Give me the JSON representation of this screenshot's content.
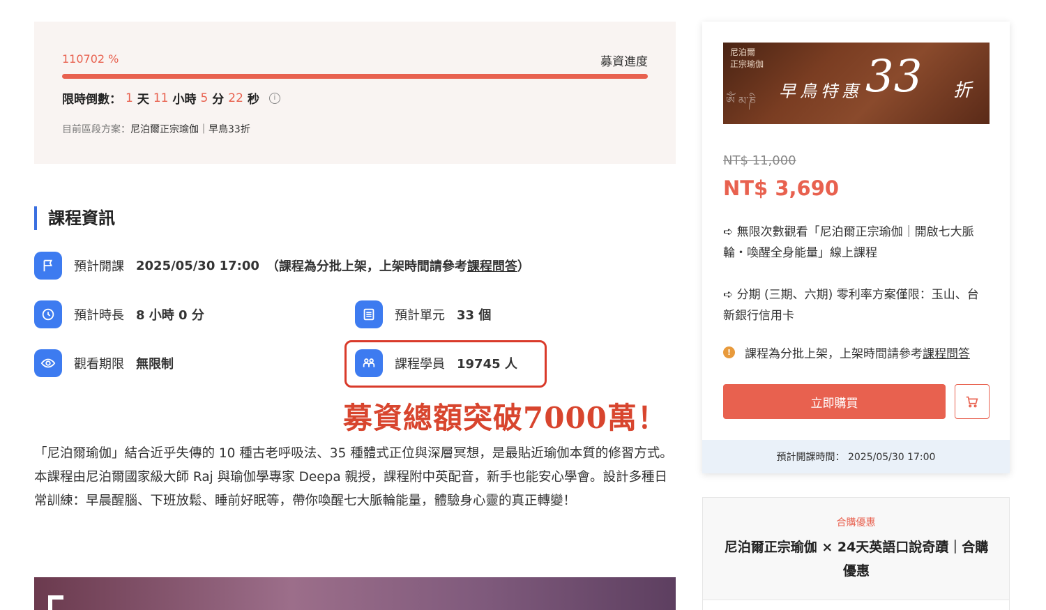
{
  "funding": {
    "percent": "110702 %",
    "label": "募資進度",
    "countdown": {
      "prefix": "限時倒數：",
      "days": "1",
      "days_unit": "天",
      "hours": "11",
      "hours_unit": "小時",
      "minutes": "5",
      "minutes_unit": "分",
      "seconds": "22",
      "seconds_unit": "秒"
    },
    "stage_label": "目前區段方案：",
    "stage_value": "尼泊爾正宗瑜伽｜早鳥33折"
  },
  "course_info": {
    "title": "課程資訊",
    "start": {
      "label": "預計開課",
      "value": "2025/05/30 17:00",
      "note_prefix": "（課程為分批上架，上架時間請參考",
      "note_link": "課程問答",
      "note_suffix": "）"
    },
    "duration": {
      "label": "預計時長",
      "value": "8 小時 0 分"
    },
    "units": {
      "label": "預計單元",
      "value": "33 個"
    },
    "access": {
      "label": "觀看期限",
      "value": "無限制"
    },
    "students": {
      "label": "課程學員",
      "value": "19745 人"
    }
  },
  "headline": "募資總額突破7000萬！",
  "description": "「尼泊爾瑜伽」結合近乎失傳的 10 種古老呼吸法、35 種體式正位與深層冥想，是最貼近瑜伽本質的修習方式。本課程由尼泊爾國家級大師 Raj 與瑜伽學專家 Deepa 親授，課程附中英配音，新手也能安心學會。設計多種日常訓練：早晨醒腦、下班放鬆、睡前好眠等，帶你喚醒七大脈輪能量，體驗身心靈的真正轉變！",
  "purchase": {
    "banner": {
      "small_line1": "尼泊爾",
      "small_line2": "正宗瑜伽",
      "promo": "早鳥特惠",
      "number": "33",
      "suffix": "折"
    },
    "old_price": "NT$ 11,000",
    "price": "NT$ 3,690",
    "feature1": "➪ 無限次數觀看「尼泊爾正宗瑜伽｜開啟七大脈輪・喚醒全身能量」線上課程",
    "feature2": "➪ 分期 (三期、六期) 零利率方案僅限：玉山、台新銀行信用卡",
    "notice_text": "課程為分批上架，上架時間請參考",
    "notice_link": "課程問答",
    "buy_label": "立即購買",
    "footer": "預計開課時間： 2025/05/30 17:00"
  },
  "bundle": {
    "tag": "合購優惠",
    "title": "尼泊爾正宗瑜伽 × 24天英語口說奇蹟｜合購優惠"
  },
  "colors": {
    "accent": "#e8614f",
    "blue": "#3d7bf0",
    "highlight_red": "#d8452e"
  }
}
